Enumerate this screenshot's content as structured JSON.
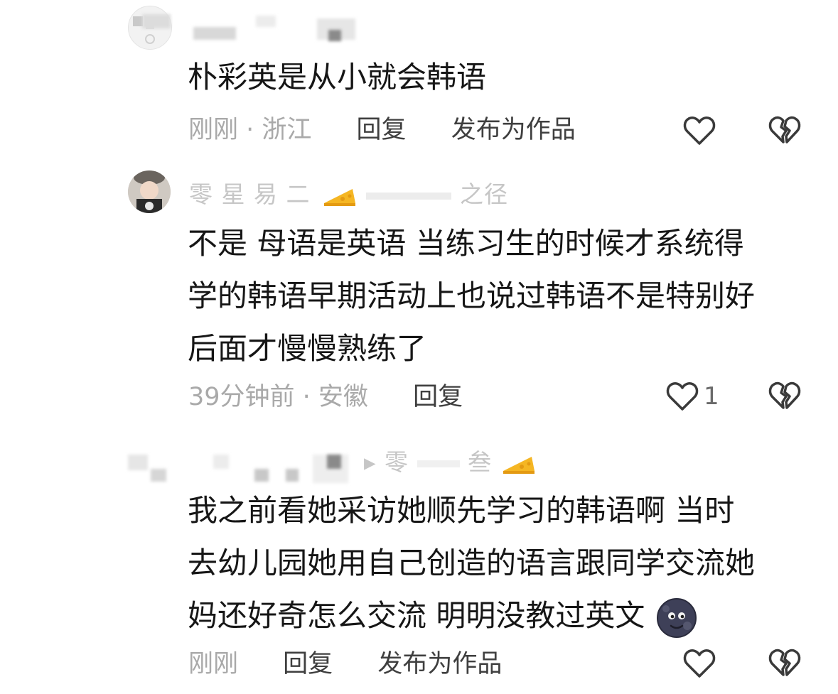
{
  "comments": [
    {
      "text_lines": [
        "朴彩英是从小就会韩语"
      ],
      "time_location": "刚刚 · 浙江",
      "reply_label": "回复",
      "publish_label": "发布为作品"
    },
    {
      "username_visible": "零 星 易 二",
      "username_suffix": "之径",
      "text_lines": [
        "不是 母语是英语 当练习生的时候才系统得",
        "学的韩语早期活动上也说过韩语不是特别好",
        "后面才慢慢熟练了"
      ],
      "time_location": "39分钟前 · 安徽",
      "reply_label": "回复",
      "like_count": "1"
    },
    {
      "username_visible": "▸ 零",
      "username_suffix": "叁",
      "text_lines": [
        "我之前看她采访她顺先学习的韩语啊 当时",
        "去幼儿园她用自己创造的语言跟同学交流她",
        "妈还好奇怎么交流 明明没教过英文"
      ],
      "time_location": "刚刚",
      "reply_label": "回复",
      "publish_label": "发布为作品"
    }
  ],
  "icons": {
    "like": "heart-outline-icon",
    "dislike": "broken-heart-icon",
    "badge": "cheese-icon",
    "emoji": "new-moon-face-emoji"
  },
  "colors": {
    "text": "#161616",
    "meta": "#a9a9a9",
    "action": "#3f3f3f",
    "icon": "#3a3a3a",
    "cheese": "#f5b623"
  }
}
